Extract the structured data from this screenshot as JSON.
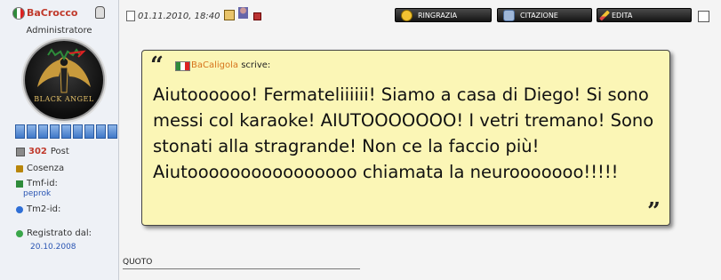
{
  "user": {
    "name": "BaCrocco",
    "role": "Administratore",
    "avatar_text": "BLACK ANGEL",
    "post_count": "302",
    "post_label": "Post",
    "city": "Cosenza",
    "tmf_label": "Tmf-id:",
    "tmf_value": "peprok",
    "tm2_label": "Tm2-id:",
    "registered_label": "Registrato dal:",
    "registered_date": "20.10.2008"
  },
  "post": {
    "date": "01.11.2010, 18:40",
    "buttons": {
      "thank": "RINGRAZIA",
      "quote": "CITAZIONE",
      "edit": "EDITA"
    },
    "quote": {
      "open_mark": "“",
      "close_mark": "”",
      "author": "BaCaligola",
      "says": "scrive:",
      "text": "Aiutoooooo! Fermateliiiiii! Siamo a casa di Diego! Si sono messi col karaoke! AIUTOOOOOOO! I vetri tremano! Sono stonati alla stragrande! Non ce la faccio più! Aiutoooooooooooooooo chiamata la neurooooooo!!!!!"
    },
    "signature_label": "QUOTO"
  },
  "colors": {
    "username": "#c0392b",
    "quote_bg": "#fbf6b6",
    "quote_author": "#d6741c",
    "link": "#2a55b3",
    "button": "#1e1e1e"
  }
}
